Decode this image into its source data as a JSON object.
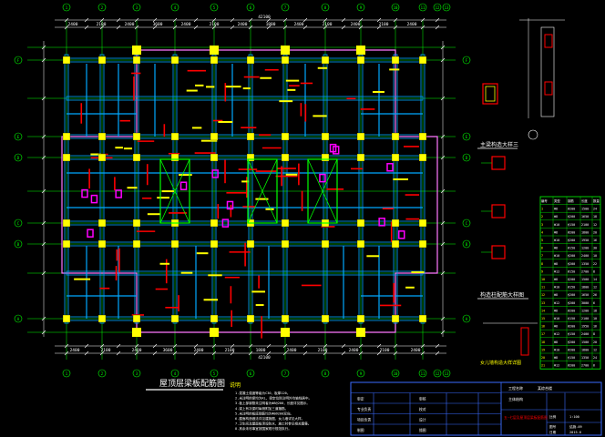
{
  "drawing": {
    "main_title": "屋顶层梁板配筋图",
    "section_title_main": "主梁构造大样三",
    "section_title_column": "构造柱配筋大样图",
    "section_title_bottom": "女儿墙构造大样详图",
    "notes_heading": "说明",
    "notes": [
      "1.混凝土强度等级为C30，板厚120。",
      "2.未注明的梁均为KL，梁定位除注明外均轴线居中。",
      "3.板上部钢筋未注明者为Φ8@200，长度详见图示。",
      "4.梁上有次梁时每侧附加三道箍筋。",
      "5.未注明的板底钢筋均为Φ8@200双向。",
      "6.屋面构造做法详见建施图，女儿墙详见大样。",
      "7.卫生间及屋面板须设防水，施工时参见相关图集。",
      "8.其余未尽事宜按国家现行规范执行。"
    ]
  },
  "dimensions": {
    "top": [
      "2400",
      "2100",
      "2400",
      "3600",
      "2400",
      "2100",
      "2400",
      "1800",
      "2400",
      "2100",
      "2400",
      "2100",
      "2400"
    ],
    "bottom": [
      "2400",
      "2100",
      "2400",
      "3600",
      "2400",
      "2100",
      "1800",
      "2400",
      "2100",
      "2400",
      "2100",
      "2400"
    ],
    "top_total": "42100",
    "bottom_total": "42100"
  },
  "axes": {
    "top_labels": [
      "1",
      "2",
      "3",
      "4",
      "5",
      "6",
      "7",
      "8",
      "9",
      "10",
      "11",
      "12",
      "13"
    ],
    "bottom_labels": [
      "1",
      "2",
      "3",
      "4",
      "5",
      "6",
      "7",
      "8",
      "9",
      "10",
      "11",
      "12",
      "13"
    ],
    "left_labels": [
      "F",
      "E",
      "D",
      "C",
      "B",
      "A"
    ],
    "right_labels": [
      "F",
      "E",
      "D",
      "C",
      "B",
      "A"
    ]
  },
  "rebar_table": {
    "header": [
      "编号",
      "类型",
      "钢筋",
      "长度",
      "数量"
    ],
    "rows": [
      [
        "1",
        "Φ8",
        "@200",
        "1500",
        "24"
      ],
      [
        "2",
        "Φ8",
        "@200",
        "1650",
        "18"
      ],
      [
        "3",
        "Φ10",
        "@150",
        "2100",
        "12"
      ],
      [
        "4",
        "Φ8",
        "@200",
        "1800",
        "20"
      ],
      [
        "5",
        "Φ10",
        "@200",
        "1950",
        "16"
      ],
      [
        "6",
        "Φ8",
        "@150",
        "1200",
        "30"
      ],
      [
        "7",
        "Φ10",
        "@200",
        "2400",
        "10"
      ],
      [
        "8",
        "Φ8",
        "@200",
        "1350",
        "22"
      ],
      [
        "9",
        "Φ12",
        "@150",
        "2700",
        "8"
      ],
      [
        "10",
        "Φ8",
        "@200",
        "1500",
        "14"
      ],
      [
        "11",
        "Φ10",
        "@150",
        "1800",
        "12"
      ],
      [
        "12",
        "Φ8",
        "@200",
        "1650",
        "26"
      ],
      [
        "13",
        "Φ12",
        "@200",
        "3000",
        "6"
      ],
      [
        "14",
        "Φ8",
        "@200",
        "1200",
        "18"
      ],
      [
        "15",
        "Φ10",
        "@150",
        "2100",
        "10"
      ],
      [
        "16",
        "Φ8",
        "@200",
        "1950",
        "16"
      ],
      [
        "17",
        "Φ12",
        "@150",
        "2400",
        "8"
      ],
      [
        "18",
        "Φ8",
        "@200",
        "1500",
        "20"
      ],
      [
        "19",
        "Φ10",
        "@200",
        "1800",
        "12"
      ],
      [
        "20",
        "Φ8",
        "@150",
        "1350",
        "24"
      ],
      [
        "21",
        "Φ12",
        "@200",
        "2700",
        "6"
      ]
    ]
  },
  "title_block": {
    "project_label": "工程名称",
    "project_value": "某综合楼",
    "drawing_name": "五~七层及屋顶层梁板配筋图",
    "sub_project": "主体结构",
    "rows_left": [
      [
        "审定",
        "",
        "审核",
        ""
      ],
      [
        "专业负责",
        "",
        "校对",
        ""
      ],
      [
        "项目负责",
        "",
        "设计",
        ""
      ],
      [
        "制图",
        "",
        "描图",
        ""
      ]
    ],
    "sheet_no_label": "图号",
    "sheet_no": "结施-09",
    "date_label": "日期",
    "date": "2015.6",
    "scale_label": "比例",
    "scale": "1:100"
  },
  "colors": {
    "background": "#000000",
    "axis_line": "#00ff00",
    "beam": "#00a8ff",
    "column": "#ffff00",
    "rebar": "#ff0000",
    "dimension": "#ffffff",
    "wall": "#ffff00",
    "outline": "#ff77ff",
    "annotation": "#ff00ff",
    "table_border": "#00ff00",
    "title_block_border": "#3b6cff"
  }
}
